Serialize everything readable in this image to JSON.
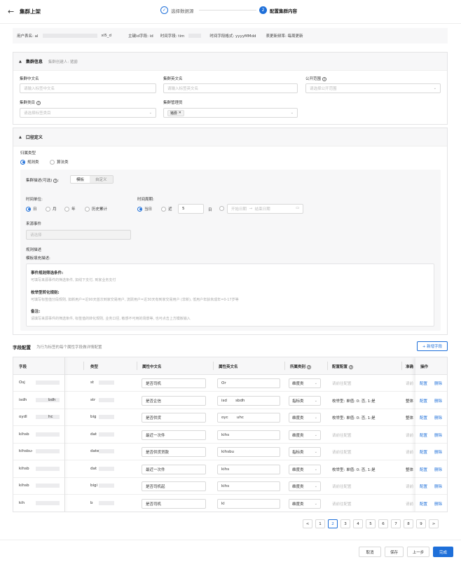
{
  "header": {
    "title": "集群上架",
    "steps": [
      {
        "index": "✓",
        "label": "选择数据源"
      },
      {
        "index": "2",
        "label": "配置集群内容"
      }
    ]
  },
  "info": {
    "table_name_label": "用户表名: al",
    "table_name_suffix": "xl5_d",
    "key_field": "主键id字段: id",
    "time_field": "时间字段: tim",
    "time_format": "时间字段格式: yyyyMMdd",
    "update_freq": "表更新频率: 每周更新"
  },
  "cluster_info": {
    "title": "集群信息",
    "creator": "集群创建人: 猪爵",
    "cn_name_label": "集群中文名",
    "cn_name_placeholder": "请输入标签中文名",
    "en_name_label": "集群英文名",
    "en_name_placeholder": "请输入标签英文名",
    "scope_label": "公开范围",
    "scope_placeholder": "请选择公开范围",
    "category_label": "集群类目",
    "category_placeholder": "请选择标签类目",
    "admin_label": "集群管理员",
    "admin_tag": "猪爵"
  },
  "metric_def": {
    "title": "口径定义",
    "type_label": "归属类型",
    "type_options": [
      "规则类",
      "算法类"
    ],
    "desc_label": "集群描述(可选)",
    "desc_modes": [
      "模板",
      "自定义"
    ],
    "time_unit_label": "时间单位:",
    "time_units": [
      "日",
      "月",
      "年",
      "历史累计"
    ],
    "time_period_label": "时间周期:",
    "period_today": "当日",
    "period_recent": "近",
    "period_value": "5",
    "period_unit": "日",
    "start_date": "开始日期",
    "arrow": "→",
    "end_date": "结束日期",
    "source_event_label": "来源事件",
    "source_event_placeholder": "请选择",
    "rule_desc_label": "规则描述",
    "template_label": "模板填充描述:",
    "blocks": [
      {
        "title": "事件规则筛选条件:",
        "text": "可填写来源事件的筛选条件, 如线下支付, 到家业务支付"
      },
      {
        "title": "枚举型转化规则:",
        "text": "可填写标签值分段规则, 如新用户=近90天首次到家交易用户, 流跃用户=近30天有到家交易用户 (非新), 低用户年龄未成年=0-17岁等"
      },
      {
        "title": "备注:",
        "text": "请填写来源事件的筛选条件, 标签值的转化规则, 业务口径, 敏感不可用的场景等, 也可点击上方模板输入"
      }
    ]
  },
  "fields": {
    "title": "字段配置",
    "subtitle": "为行为标签的每个属性字段做详情配置",
    "add_button": "+ 新增字段",
    "columns": [
      "字段",
      "类型",
      "属性中文名",
      "属性英文名",
      "所属类别",
      "配置配置",
      "准确",
      "操作"
    ],
    "rows": [
      {
        "field": "Osj",
        "type": "st",
        "cn": "是否司机",
        "en": "Or",
        "cat": "维度类",
        "config": "请前往配置",
        "acc": "请前",
        "cfg_muted": true
      },
      {
        "field": "isdh",
        "field2": "bdh",
        "type": "str",
        "cn": "是否企信",
        "en": "isd",
        "en2": "sbdh",
        "cat": "指标类",
        "config": "枚举型: 单值: 0: 否, 1:是",
        "acc": "整体",
        "cfg_muted": false
      },
      {
        "field": "oydl",
        "field2": "hc",
        "type": "big",
        "cn": "是否供货",
        "en": "oyc",
        "en2": "uhc",
        "cat": "维度类",
        "config": "枚举型: 单值: 0: 否, 1:是",
        "acc": "整体",
        "cfg_muted": false
      },
      {
        "field": "kihsb",
        "type": "dat",
        "cn": "最近一次件",
        "en": "kihs",
        "cat": "维度类",
        "config": "请前往配置",
        "acc": "请前",
        "cfg_muted": true
      },
      {
        "field": "kihsbu-",
        "type": "datetı",
        "cn": "是否供货贷款",
        "en": "kihsbu",
        "cat": "指标类",
        "config": "请前往配置",
        "acc": "请前",
        "cfg_muted": true
      },
      {
        "field": "kihsb",
        "type": "dat",
        "cn": "最近一次件",
        "en": "kihs",
        "cat": "维度类",
        "config": "枚举型: 单值: 0: 否, 1:是",
        "acc": "整体",
        "cfg_muted": false
      },
      {
        "field": "kihsb",
        "type": "bigi",
        "cn": "是否司机起",
        "en": "kihs",
        "cat": "维度类",
        "config": "请前往配置",
        "acc": "请前",
        "cfg_muted": true
      },
      {
        "field": "kih",
        "type": "b",
        "cn": "是否司机",
        "en": "kl",
        "cat": "维度类",
        "config": "请前往配置",
        "acc": "请前",
        "cfg_muted": true
      }
    ],
    "actions": [
      "配置",
      "删除"
    ]
  },
  "pager": {
    "prev": "<",
    "pages": [
      "1",
      "2",
      "3",
      "4",
      "5",
      "6",
      "7",
      "8",
      "9"
    ],
    "current": "2",
    "next": ">"
  },
  "footer": {
    "cancel": "取消",
    "save": "保存",
    "prev": "上一步",
    "done": "完成"
  },
  "colors": {
    "primary": "#1e6fd9"
  }
}
